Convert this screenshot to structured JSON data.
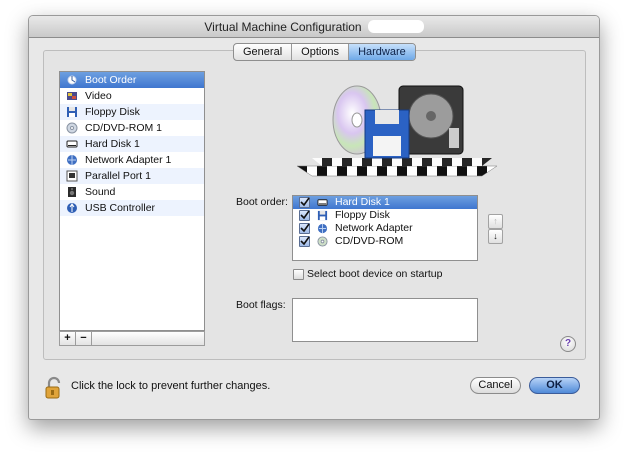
{
  "window": {
    "title": "Virtual Machine Configuration"
  },
  "tabs": [
    {
      "label": "General",
      "active": false
    },
    {
      "label": "Options",
      "active": false
    },
    {
      "label": "Hardware",
      "active": true
    }
  ],
  "sidebar": {
    "items": [
      {
        "label": "Boot Order",
        "icon": "boot-order-icon"
      },
      {
        "label": "Video",
        "icon": "video-icon"
      },
      {
        "label": "Floppy Disk",
        "icon": "floppy-disk-icon"
      },
      {
        "label": "CD/DVD-ROM 1",
        "icon": "cd-dvd-icon"
      },
      {
        "label": "Hard Disk 1",
        "icon": "hard-disk-icon"
      },
      {
        "label": "Network Adapter 1",
        "icon": "network-adapter-icon"
      },
      {
        "label": "Parallel Port 1",
        "icon": "parallel-port-icon"
      },
      {
        "label": "Sound",
        "icon": "sound-icon"
      },
      {
        "label": "USB Controller",
        "icon": "usb-controller-icon"
      }
    ],
    "selected": 0,
    "add_label": "+",
    "remove_label": "−"
  },
  "boot": {
    "order_label": "Boot order:",
    "items": [
      {
        "label": "Hard Disk 1",
        "checked": true,
        "icon": "hard-disk-icon"
      },
      {
        "label": "Floppy Disk",
        "checked": true,
        "icon": "floppy-disk-icon"
      },
      {
        "label": "Network Adapter",
        "checked": true,
        "icon": "network-adapter-icon"
      },
      {
        "label": "CD/DVD-ROM",
        "checked": true,
        "icon": "cd-dvd-icon"
      }
    ],
    "selected": 0,
    "up_label": "↑",
    "down_label": "↓",
    "select_device_label": "Select boot device on startup",
    "select_device_checked": false,
    "flags_label": "Boot flags:",
    "flags_value": ""
  },
  "footer": {
    "lock_text": "Click the lock to prevent further changes.",
    "cancel_label": "Cancel",
    "ok_label": "OK",
    "help_label": "?"
  },
  "colors": {
    "selection": "#3f76cf",
    "window_bg": "#e8e8e8",
    "ok_button": "#4f8ad8"
  }
}
